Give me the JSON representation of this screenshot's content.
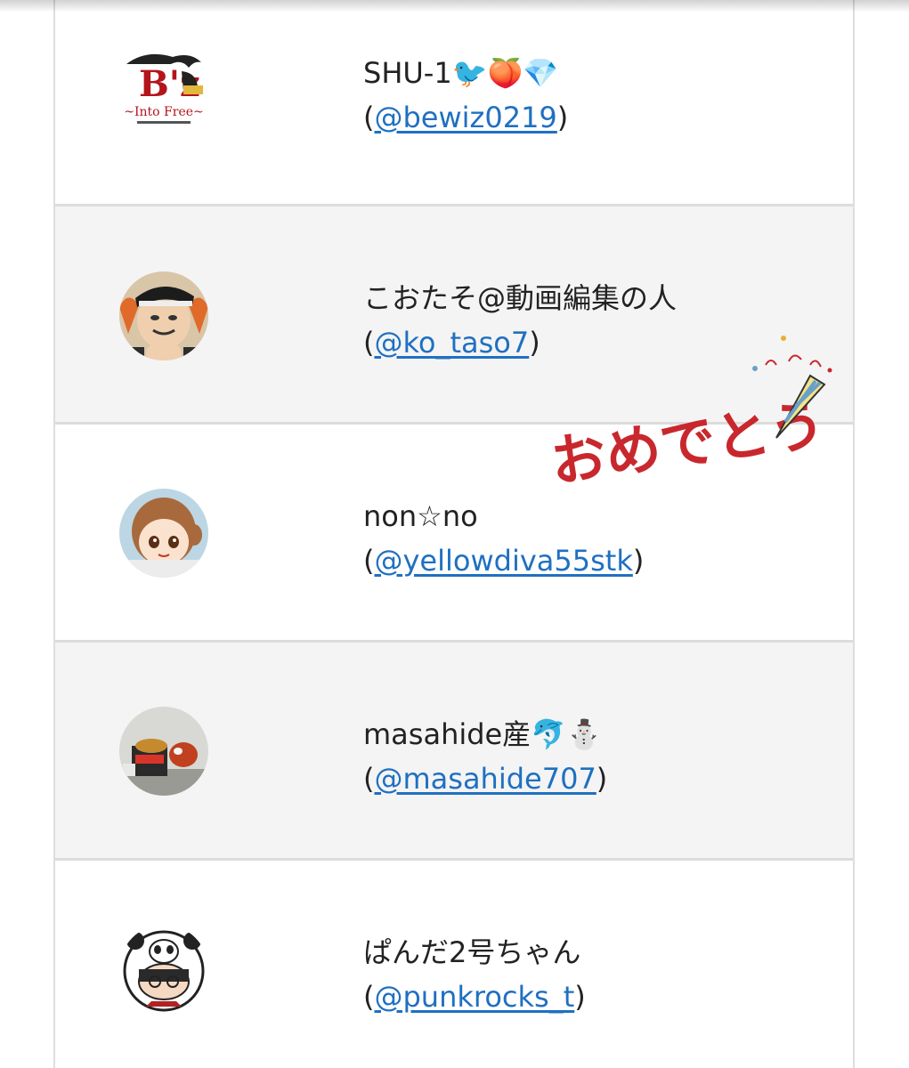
{
  "users": [
    {
      "name": "SHU-1🐦🍑💎",
      "handle": "@bewiz0219",
      "avatar": "bz-into-free-logo"
    },
    {
      "name": "こおたそ@動画編集の人",
      "handle": "@ko_taso7",
      "avatar": "man-with-cap-avatar"
    },
    {
      "name": "non☆no",
      "handle": "@yellowdiva55stk",
      "avatar": "anime-girl-avatar"
    },
    {
      "name": "masahide産🐬⛄",
      "handle": "@masahide707",
      "avatar": "merchandise-photo-avatar"
    },
    {
      "name": "ぱんだ2号ちゃん",
      "handle": "@punkrocks_t",
      "avatar": "panda-hood-avatar"
    }
  ],
  "logo_text": {
    "main": "B'z",
    "sub": "~Into Free~"
  },
  "sticker": {
    "text": "おめでとう",
    "color": "#c8282d"
  },
  "colors": {
    "link": "#1f70c1",
    "row_alt": "#f4f4f4",
    "divider": "#dcdcdc"
  }
}
